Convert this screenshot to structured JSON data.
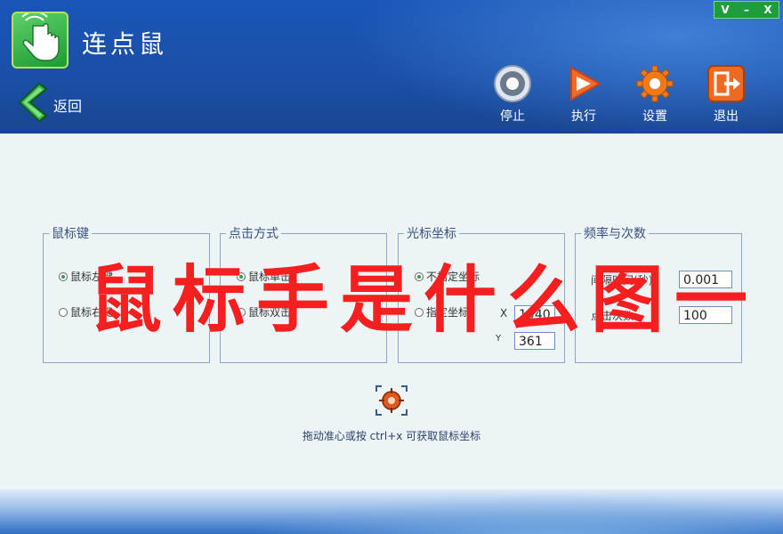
{
  "window": {
    "controls": [
      "V",
      "–",
      "X"
    ]
  },
  "header": {
    "app_title": "连点鼠",
    "back_label": "返回"
  },
  "toolbar": {
    "stop_label": "停止",
    "run_label": "执行",
    "settings_label": "设置",
    "exit_label": "退出"
  },
  "groups": {
    "mouse_button": {
      "title": "鼠标键",
      "options": [
        "鼠标左键",
        "鼠标右键"
      ],
      "selected": "鼠标左键"
    },
    "click_mode": {
      "title": "点击方式",
      "options": [
        "鼠标单击",
        "鼠标双击"
      ],
      "selected": "鼠标单击"
    },
    "cursor_coords": {
      "title": "光标坐标",
      "options": [
        "不指定坐标",
        "指定坐标"
      ],
      "selected": "不指定坐标",
      "x_label": "X",
      "x_value": "1540",
      "y_label": "Y",
      "y_value": "361"
    },
    "frequency": {
      "title": "频率与次数",
      "interval_label": "间隔时间(秒):",
      "interval_value": "0.001",
      "count_label": "点击次数:",
      "count_value": "100"
    }
  },
  "hint": "拖动准心或按 ctrl+x 可获取鼠标坐标",
  "watermark": "鼠标手是什么图一",
  "colors": {
    "header_blue": "#1b4fa8",
    "content_bg": "#edf4f6",
    "accent_green": "#1d9d3c",
    "watermark_red": "#f51f1f"
  },
  "icons": {
    "logo": "hand-pointer-icon",
    "back": "chevron-left-icon",
    "stop": "stop-icon",
    "run": "play-icon",
    "settings": "gear-icon",
    "exit": "exit-icon",
    "crosshair": "crosshair-icon"
  }
}
